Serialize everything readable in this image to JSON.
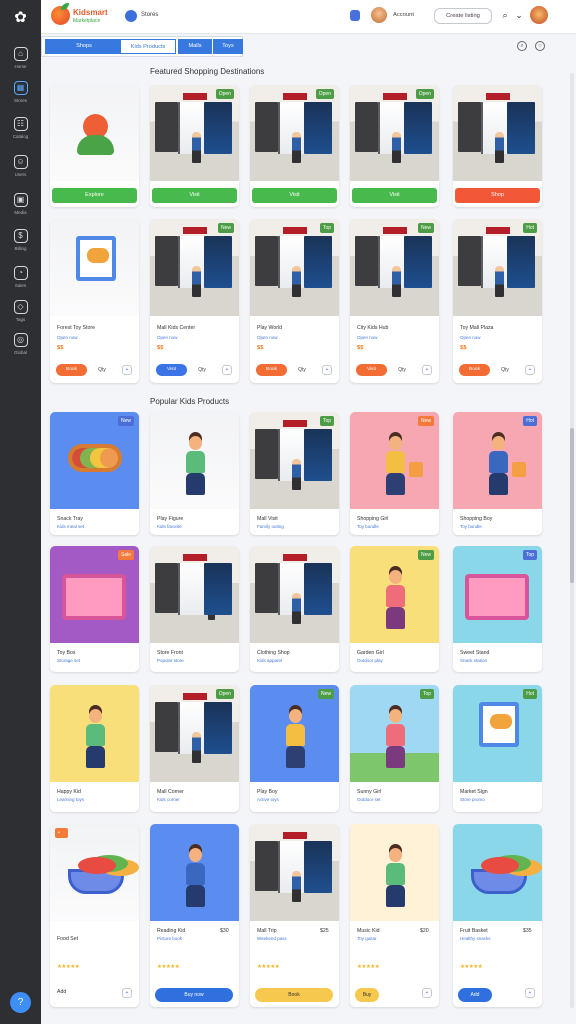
{
  "sidebar": {
    "logo": "✿",
    "items": [
      {
        "label": "Home",
        "icon": "home-icon",
        "glyph": "⌂"
      },
      {
        "label": "Stores",
        "icon": "store-icon",
        "glyph": "▦"
      },
      {
        "label": "Catalog",
        "icon": "catalog-icon",
        "glyph": "☷"
      },
      {
        "label": "Users",
        "icon": "users-icon",
        "glyph": "☺"
      },
      {
        "label": "Media",
        "icon": "media-icon",
        "glyph": "▣"
      },
      {
        "label": "Billing",
        "icon": "billing-icon",
        "glyph": "$"
      },
      {
        "label": "Sales",
        "icon": "sales-icon",
        "glyph": "◔"
      },
      {
        "label": "Tags",
        "icon": "tags-icon",
        "glyph": "◇"
      },
      {
        "label": "Global",
        "icon": "globe-icon",
        "glyph": "◎"
      }
    ],
    "help": "?"
  },
  "header": {
    "brand_name": "Kidsmart",
    "brand_sub": "Marketplace",
    "nav_label": "Stores",
    "user_name": "Account",
    "button": "Create listing",
    "search_glyph": "⌕",
    "filter_glyph": "⌄"
  },
  "tabs": [
    "Shops",
    "Kids Products",
    "Malls",
    "Toys"
  ],
  "section_titles": [
    "Featured Shopping Destinations",
    "Popular Kids Products"
  ],
  "shops": [
    {
      "theme": "tree",
      "button": "Explore",
      "btn_color": "green"
    },
    {
      "theme": "mall",
      "button": "Visit",
      "btn_color": "green",
      "badge": "Open",
      "badge_color": "green"
    },
    {
      "theme": "mall",
      "button": "Visit",
      "btn_color": "green",
      "badge": "Open",
      "badge_color": "green"
    },
    {
      "theme": "mall",
      "button": "Visit",
      "btn_color": "green",
      "badge": "Open",
      "badge_color": "green"
    },
    {
      "theme": "mall",
      "button": "Shop",
      "btn_color": "orange"
    }
  ],
  "shop_details": [
    {
      "theme": "poster",
      "name": "Forest Toy Store",
      "sub": "Open now",
      "price": "$$",
      "button": "Book",
      "qty": "Qty",
      "btn_color": "orange"
    },
    {
      "theme": "mall",
      "name": "Mall Kids Center",
      "sub": "Open now",
      "price": "$$",
      "button": "Visit",
      "qty": "Qty",
      "btn_color": "blue",
      "badge": "New",
      "badge_color": "green"
    },
    {
      "theme": "mall",
      "name": "Play World",
      "sub": "Open now",
      "price": "$$",
      "button": "Book",
      "qty": "Qty",
      "btn_color": "orange",
      "badge": "Top",
      "badge_color": "green"
    },
    {
      "theme": "mall",
      "name": "City Kids Hub",
      "sub": "Open now",
      "price": "$$",
      "button": "Visit",
      "qty": "Qty",
      "btn_color": "orange",
      "badge": "New",
      "badge_color": "green"
    },
    {
      "theme": "mall",
      "name": "Toy Mall Plaza",
      "sub": "Open now",
      "price": "$$",
      "button": "Book",
      "qty": "Qty",
      "btn_color": "orange",
      "badge": "Hot",
      "badge_color": "green"
    }
  ],
  "products": [
    {
      "theme": "food",
      "bg": "blue",
      "name": "Snack Tray",
      "sub": "Kids meal set",
      "badge": "New",
      "badge_color": "blue"
    },
    {
      "theme": "kid",
      "bg": "plain",
      "name": "Play Figure",
      "sub": "Kids favorite",
      "kid": "green"
    },
    {
      "theme": "mall",
      "bg": "plain",
      "name": "Mall Visit",
      "sub": "Family outing",
      "badge": "Top",
      "badge_color": "green"
    },
    {
      "theme": "kid",
      "bg": "pink",
      "name": "Shopping Girl",
      "sub": "Toy bundle",
      "kid": "orange",
      "bag": true,
      "badge": "New",
      "badge_color": "orange"
    },
    {
      "theme": "kid",
      "bg": "pink",
      "name": "Shopping Boy",
      "sub": "Toy bundle",
      "kid": "blue",
      "bag": true,
      "badge": "Hot",
      "badge_color": "blue"
    },
    {
      "theme": "box",
      "bg": "purple",
      "name": "Toy Box",
      "sub": "Storage set",
      "badge": "Sale",
      "badge_color": "orange"
    },
    {
      "theme": "mall",
      "bg": "plain",
      "name": "Store Front",
      "sub": "Popular store"
    },
    {
      "theme": "mall",
      "bg": "plain",
      "name": "Clothing Shop",
      "sub": "Kids apparel"
    },
    {
      "theme": "kid",
      "bg": "yellow",
      "name": "Garden Girl",
      "sub": "Outdoor play",
      "kid": "pink",
      "badge": "New",
      "badge_color": "green"
    },
    {
      "theme": "box",
      "bg": "cyan",
      "name": "Sweet Stand",
      "sub": "Snack station",
      "badge": "Top",
      "badge_color": "blue"
    },
    {
      "theme": "kid",
      "bg": "yellow",
      "name": "Happy Kid",
      "sub": "Learning toys",
      "kid": "green"
    },
    {
      "theme": "mall",
      "bg": "plain",
      "name": "Mall Corner",
      "sub": "Kids corner",
      "badge": "Open",
      "badge_color": "green"
    },
    {
      "theme": "kid",
      "bg": "blue",
      "name": "Play Boy",
      "sub": "Active toys",
      "kid": "orange",
      "badge": "New",
      "badge_color": "green"
    },
    {
      "theme": "kid",
      "bg": "sky",
      "name": "Sunny Girl",
      "sub": "Outdoor set",
      "kid": "pink",
      "badge": "Top",
      "badge_color": "green"
    },
    {
      "theme": "poster",
      "bg": "cyan",
      "name": "Market Sign",
      "sub": "Store promo",
      "badge": "Hot",
      "badge_color": "green"
    }
  ],
  "reviews": [
    {
      "theme": "bowl",
      "bg": "plain",
      "name": "Food Set",
      "sub": "",
      "stars": "★★★★★",
      "button": "Add",
      "btn_color": "white"
    },
    {
      "theme": "kid",
      "bg": "blue",
      "name": "Reading Kid",
      "sub": "Picture book",
      "stars": "★★★★★",
      "button": "Buy now",
      "btn_color": "blue",
      "price": "$30",
      "kid": "blue"
    },
    {
      "theme": "mall",
      "bg": "plain",
      "name": "Mall Trip",
      "sub": "Weekend pass",
      "stars": "★★★★★",
      "button": "Book",
      "btn_color": "yellow",
      "price": "$25"
    },
    {
      "theme": "kid",
      "bg": "cream",
      "name": "Music Kid",
      "sub": "Toy guitar",
      "stars": "★★★★★",
      "button": "Buy",
      "btn_color": "yellow",
      "price": "$20"
    },
    {
      "theme": "bowl",
      "bg": "cyan",
      "name": "Fruit Basket",
      "sub": "Healthy snacks",
      "stars": "★★★★★",
      "button": "Add",
      "btn_color": "blue",
      "price": "$35"
    }
  ],
  "colors": {
    "accent": "#3779df",
    "success": "#48b94d",
    "warning": "#f25837",
    "sidebar": "#2d2f33"
  }
}
